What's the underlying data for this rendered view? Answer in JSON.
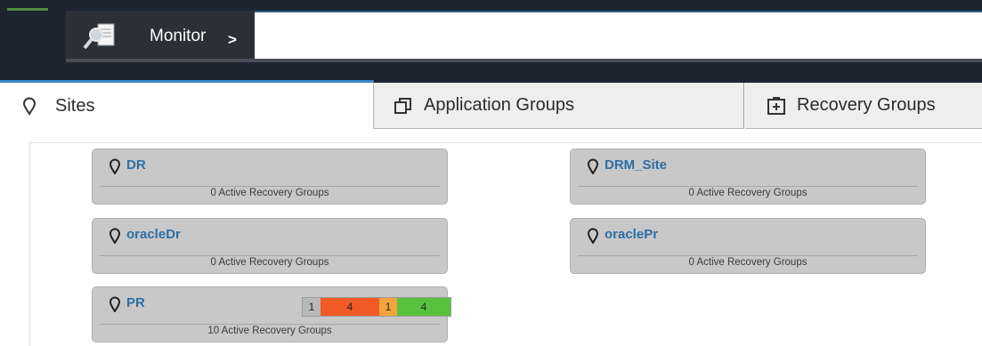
{
  "header": {
    "breadcrumb_label": "Monitor",
    "breadcrumb_arrow": ">",
    "breadcrumb_icon": "monitor-magnifier-icon"
  },
  "tabs": [
    {
      "label": "Sites",
      "icon": "location-pin-icon",
      "active": true
    },
    {
      "label": "Application Groups",
      "icon": "copy-windows-icon",
      "active": false
    },
    {
      "label": "Recovery Groups",
      "icon": "plus-box-icon",
      "active": false
    }
  ],
  "sites": [
    {
      "name": "DR",
      "footer": "0 Active Recovery Groups"
    },
    {
      "name": "DRM_Site",
      "footer": "0 Active Recovery Groups"
    },
    {
      "name": "oracleDr",
      "footer": "0 Active Recovery Groups"
    },
    {
      "name": "oraclePr",
      "footer": "0 Active Recovery Groups"
    },
    {
      "name": "PR",
      "footer": "10 Active Recovery Groups",
      "stats": [
        {
          "value": "1",
          "color": "#b9b9b9"
        },
        {
          "value": "4",
          "color": "#f05a24"
        },
        {
          "value": "1",
          "color": "#f2a53c"
        },
        {
          "value": "4",
          "color": "#58c23c"
        }
      ]
    }
  ],
  "colors": {
    "accent": "#3a86c6",
    "site_name": "#2f6fa3",
    "card_bg": "#c8c8c8",
    "header_bg": "#1c2530"
  }
}
